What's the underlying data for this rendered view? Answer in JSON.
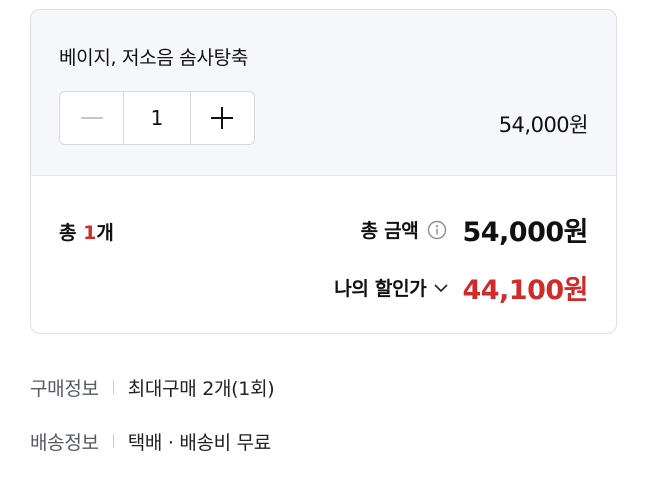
{
  "option": {
    "name": "베이지, 저소음 솜사탕축",
    "quantity": "1",
    "price": "54,000원"
  },
  "summary": {
    "count_prefix": "총 ",
    "count_value": "1",
    "count_suffix": "개",
    "total_label": "총 금액",
    "total_amount": "54,000원",
    "discount_label": "나의 할인가",
    "discount_amount": "44,100원"
  },
  "info": [
    {
      "key": "구매정보",
      "value": "최대구매 2개(1회)"
    },
    {
      "key": "배송정보",
      "value": "택배 · 배송비 무료"
    }
  ],
  "icons": {
    "minus": "minus-icon",
    "plus": "plus-icon",
    "info": "info-circle-icon",
    "chevron": "chevron-down-icon"
  },
  "colors": {
    "accent_red": "#d02a2a",
    "option_bg": "#f6f7fb",
    "border": "#dcdfe6"
  }
}
